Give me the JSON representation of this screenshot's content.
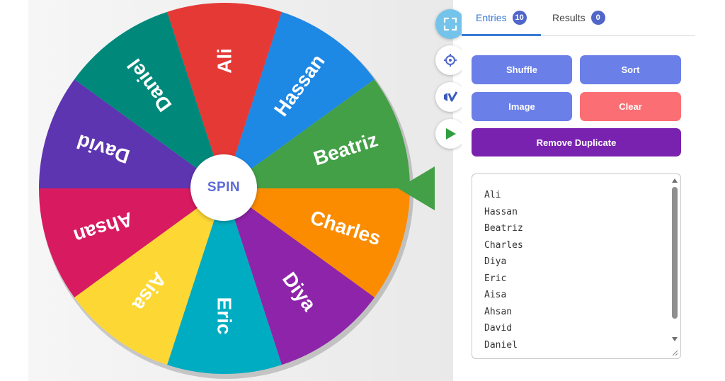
{
  "wheel": {
    "spin_label": "SPIN",
    "slices": [
      {
        "name": "Ali",
        "color": "#e53935"
      },
      {
        "name": "Hassan",
        "color": "#1e88e5"
      },
      {
        "name": "Beatriz",
        "color": "#43a047"
      },
      {
        "name": "Charles",
        "color": "#fb8c00"
      },
      {
        "name": "Diya",
        "color": "#8e24aa"
      },
      {
        "name": "Eric",
        "color": "#00acc1"
      },
      {
        "name": "Aisa",
        "color": "#fdd835"
      },
      {
        "name": "Ahsan",
        "color": "#d81b60"
      },
      {
        "name": "David",
        "color": "#5e35b1"
      },
      {
        "name": "Daniel",
        "color": "#00897b"
      }
    ],
    "pointer_color": "#43a047"
  },
  "tools": [
    {
      "icon": "fullscreen-icon",
      "active": true
    },
    {
      "icon": "settings-icon",
      "active": false
    },
    {
      "icon": "share-icon",
      "active": false
    },
    {
      "icon": "play-icon",
      "active": false
    }
  ],
  "tabs": {
    "entries": {
      "label": "Entries",
      "count": "10"
    },
    "results": {
      "label": "Results",
      "count": "0"
    }
  },
  "buttons": {
    "shuffle": "Shuffle",
    "sort": "Sort",
    "image": "Image",
    "clear": "Clear",
    "remove_duplicate": "Remove Duplicate"
  },
  "entries": [
    "Ali",
    "Hassan",
    "Beatriz",
    "Charles",
    "Diya",
    "Eric",
    "Aisa",
    "Ahsan",
    "David",
    "Daniel"
  ],
  "colors": {
    "accent": "#3a7bd5",
    "button_blue": "#6a7fe8",
    "button_red": "#fb6f74",
    "button_purple": "#7a22b0"
  }
}
